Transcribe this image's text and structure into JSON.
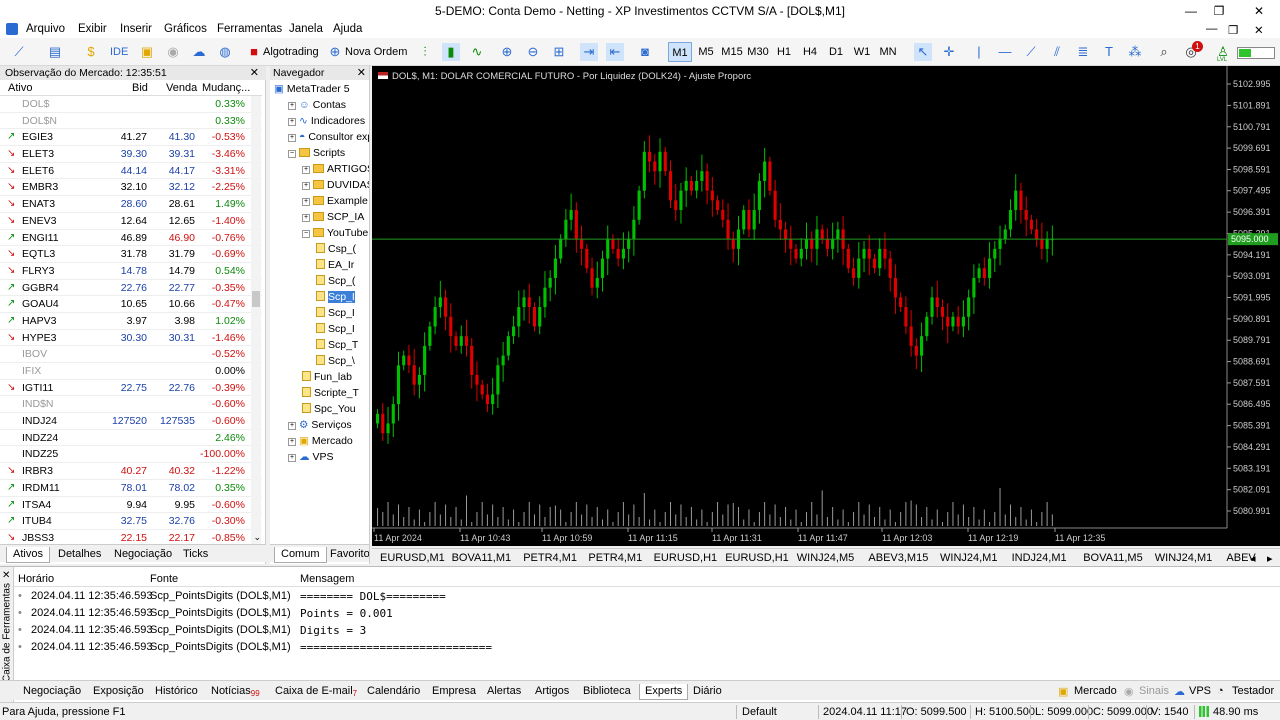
{
  "window": {
    "title": "5-DEMO: Conta Demo - Netting - XP Investimentos CCTVM S/A - [DOL$,M1]"
  },
  "menu": [
    "Arquivo",
    "Exibir",
    "Inserir",
    "Gráficos",
    "Ferramentas",
    "Janela",
    "Ajuda"
  ],
  "toolbar": {
    "ide": "IDE",
    "algotrading": "Algotrading",
    "nova_ordem": "Nova Ordem",
    "timeframes": [
      "M1",
      "M5",
      "M15",
      "M30",
      "H1",
      "H4",
      "D1",
      "W1",
      "MN"
    ],
    "active_timeframe": "M1",
    "notification_count": "1",
    "level_label": "LVL"
  },
  "market_watch": {
    "header": "Observação do Mercado: 12:35:51",
    "columns": [
      "Ativo",
      "Bid",
      "Venda",
      "Mudanç..."
    ],
    "rows": [
      {
        "symbol": "DOL$",
        "bid": "",
        "ask": "",
        "change": "0.33%",
        "dir": "none",
        "state": "inactive",
        "bidc": "",
        "askc": "",
        "chgc": "up"
      },
      {
        "symbol": "DOL$N",
        "bid": "",
        "ask": "",
        "change": "0.33%",
        "dir": "none",
        "state": "inactive",
        "bidc": "",
        "askc": "",
        "chgc": "up"
      },
      {
        "symbol": "EGIE3",
        "bid": "41.27",
        "ask": "41.30",
        "change": "-0.53%",
        "dir": "up",
        "state": "",
        "bidc": "",
        "askc": "bluev",
        "chgc": "dn"
      },
      {
        "symbol": "ELET3",
        "bid": "39.30",
        "ask": "39.31",
        "change": "-3.46%",
        "dir": "dn",
        "state": "",
        "bidc": "bluev",
        "askc": "bluev",
        "chgc": "dn"
      },
      {
        "symbol": "ELET6",
        "bid": "44.14",
        "ask": "44.17",
        "change": "-3.31%",
        "dir": "dn",
        "state": "",
        "bidc": "bluev",
        "askc": "bluev",
        "chgc": "dn"
      },
      {
        "symbol": "EMBR3",
        "bid": "32.10",
        "ask": "32.12",
        "change": "-2.25%",
        "dir": "dn",
        "state": "",
        "bidc": "",
        "askc": "bluev",
        "chgc": "dn"
      },
      {
        "symbol": "ENAT3",
        "bid": "28.60",
        "ask": "28.61",
        "change": "1.49%",
        "dir": "dn",
        "state": "",
        "bidc": "bluev",
        "askc": "",
        "chgc": "up"
      },
      {
        "symbol": "ENEV3",
        "bid": "12.64",
        "ask": "12.65",
        "change": "-1.40%",
        "dir": "dn",
        "state": "",
        "bidc": "",
        "askc": "",
        "chgc": "dn"
      },
      {
        "symbol": "ENGI11",
        "bid": "46.89",
        "ask": "46.90",
        "change": "-0.76%",
        "dir": "up",
        "state": "",
        "bidc": "",
        "askc": "redv",
        "chgc": "dn"
      },
      {
        "symbol": "EQTL3",
        "bid": "31.78",
        "ask": "31.79",
        "change": "-0.69%",
        "dir": "dn",
        "state": "",
        "bidc": "",
        "askc": "",
        "chgc": "dn"
      },
      {
        "symbol": "FLRY3",
        "bid": "14.78",
        "ask": "14.79",
        "change": "0.54%",
        "dir": "dn",
        "state": "",
        "bidc": "bluev",
        "askc": "",
        "chgc": "up"
      },
      {
        "symbol": "GGBR4",
        "bid": "22.76",
        "ask": "22.77",
        "change": "-0.35%",
        "dir": "up",
        "state": "",
        "bidc": "bluev",
        "askc": "bluev",
        "chgc": "dn"
      },
      {
        "symbol": "GOAU4",
        "bid": "10.65",
        "ask": "10.66",
        "change": "-0.47%",
        "dir": "up",
        "state": "",
        "bidc": "",
        "askc": "",
        "chgc": "dn"
      },
      {
        "symbol": "HAPV3",
        "bid": "3.97",
        "ask": "3.98",
        "change": "1.02%",
        "dir": "up",
        "state": "",
        "bidc": "",
        "askc": "",
        "chgc": "up"
      },
      {
        "symbol": "HYPE3",
        "bid": "30.30",
        "ask": "30.31",
        "change": "-1.46%",
        "dir": "dn",
        "state": "",
        "bidc": "bluev",
        "askc": "bluev",
        "chgc": "dn"
      },
      {
        "symbol": "IBOV",
        "bid": "",
        "ask": "",
        "change": "-0.52%",
        "dir": "none",
        "state": "inactive",
        "bidc": "",
        "askc": "",
        "chgc": "dn"
      },
      {
        "symbol": "IFIX",
        "bid": "",
        "ask": "",
        "change": "0.00%",
        "dir": "none",
        "state": "inactive",
        "bidc": "",
        "askc": "",
        "chgc": ""
      },
      {
        "symbol": "IGTI11",
        "bid": "22.75",
        "ask": "22.76",
        "change": "-0.39%",
        "dir": "dn",
        "state": "",
        "bidc": "bluev",
        "askc": "bluev",
        "chgc": "dn"
      },
      {
        "symbol": "IND$N",
        "bid": "",
        "ask": "",
        "change": "-0.60%",
        "dir": "none",
        "state": "inactive",
        "bidc": "",
        "askc": "",
        "chgc": "dn"
      },
      {
        "symbol": "INDJ24",
        "bid": "127520",
        "ask": "127535",
        "change": "-0.60%",
        "dir": "none",
        "state": "",
        "bidc": "bluev",
        "askc": "bluev",
        "chgc": "dn"
      },
      {
        "symbol": "INDZ24",
        "bid": "",
        "ask": "",
        "change": "2.46%",
        "dir": "none",
        "state": "",
        "bidc": "",
        "askc": "",
        "chgc": "up"
      },
      {
        "symbol": "INDZ25",
        "bid": "",
        "ask": "",
        "change": "-100.00%",
        "dir": "none",
        "state": "",
        "bidc": "",
        "askc": "",
        "chgc": "dn"
      },
      {
        "symbol": "IRBR3",
        "bid": "40.27",
        "ask": "40.32",
        "change": "-1.22%",
        "dir": "dn",
        "state": "",
        "bidc": "redv",
        "askc": "redv",
        "chgc": "dn"
      },
      {
        "symbol": "IRDM11",
        "bid": "78.01",
        "ask": "78.02",
        "change": "0.35%",
        "dir": "up",
        "state": "",
        "bidc": "bluev",
        "askc": "bluev",
        "chgc": "up"
      },
      {
        "symbol": "ITSA4",
        "bid": "9.94",
        "ask": "9.95",
        "change": "-0.60%",
        "dir": "up",
        "state": "",
        "bidc": "",
        "askc": "",
        "chgc": "dn"
      },
      {
        "symbol": "ITUB4",
        "bid": "32.75",
        "ask": "32.76",
        "change": "-0.30%",
        "dir": "up",
        "state": "",
        "bidc": "bluev",
        "askc": "bluev",
        "chgc": "dn"
      },
      {
        "symbol": "JBSS3",
        "bid": "22.15",
        "ask": "22.17",
        "change": "-0.85%",
        "dir": "dn",
        "state": "",
        "bidc": "redv",
        "askc": "redv",
        "chgc": "dn"
      }
    ],
    "tabs": [
      "Ativos",
      "Detalhes",
      "Negociação",
      "Ticks"
    ]
  },
  "navigator": {
    "header": "Navegador",
    "items": [
      {
        "label": "MetaTrader 5",
        "kind": "root",
        "level": 0
      },
      {
        "label": "Contas",
        "kind": "accounts",
        "level": 1
      },
      {
        "label": "Indicadores",
        "kind": "indicators",
        "level": 1
      },
      {
        "label": "Consultor exp",
        "kind": "experts",
        "level": 1
      },
      {
        "label": "Scripts",
        "kind": "folder",
        "level": 1
      },
      {
        "label": "ARTIGOS",
        "kind": "folder",
        "level": 2
      },
      {
        "label": "DUVIDAS",
        "kind": "folder",
        "level": 2
      },
      {
        "label": "Example",
        "kind": "folder",
        "level": 2
      },
      {
        "label": "SCP_IA",
        "kind": "folder",
        "level": 2
      },
      {
        "label": "YouTube",
        "kind": "folder",
        "level": 2
      },
      {
        "label": "Csp_(",
        "kind": "script",
        "level": 3
      },
      {
        "label": "EA_Ir",
        "kind": "script",
        "level": 3
      },
      {
        "label": "Scp_(",
        "kind": "script",
        "level": 3
      },
      {
        "label": "Scp_I",
        "kind": "script",
        "level": 3,
        "selected": true
      },
      {
        "label": "Scp_I",
        "kind": "script",
        "level": 3
      },
      {
        "label": "Scp_I",
        "kind": "script",
        "level": 3
      },
      {
        "label": "Scp_T",
        "kind": "script",
        "level": 3
      },
      {
        "label": "Scp_\\",
        "kind": "script",
        "level": 3
      },
      {
        "label": "Fun_lab",
        "kind": "script",
        "level": 2
      },
      {
        "label": "Scripte_T",
        "kind": "script",
        "level": 2
      },
      {
        "label": "Spc_You",
        "kind": "script",
        "level": 2
      },
      {
        "label": "Serviços",
        "kind": "services",
        "level": 1
      },
      {
        "label": "Mercado",
        "kind": "market",
        "level": 1
      },
      {
        "label": "VPS",
        "kind": "vps",
        "level": 1
      }
    ],
    "tabs": [
      "Comum",
      "Favorito"
    ]
  },
  "chart": {
    "info": "DOL$, M1:  DOLAR COMERCIAL FUTURO - Por Liquidez (DOLK24) - Ajuste Proporc",
    "current_price": "5095.000",
    "bull_color": "#00c000",
    "bear_color": "#e00000"
  },
  "chart_data": {
    "type": "candlestick",
    "symbol": "DOL$",
    "timeframe": "M1",
    "y_ticks": [
      "5102.995",
      "5101.891",
      "5100.791",
      "5099.691",
      "5098.591",
      "5097.495",
      "5096.391",
      "5095.291",
      "5094.191",
      "5093.091",
      "5091.995",
      "5090.891",
      "5089.791",
      "5088.691",
      "5087.591",
      "5086.495",
      "5085.391",
      "5084.291",
      "5083.191",
      "5082.091",
      "5080.991"
    ],
    "y_range": [
      5080.5,
      5103.5
    ],
    "x_ticks": [
      "11 Apr 2024",
      "11 Apr 10:43",
      "11 Apr 10:59",
      "11 Apr 11:15",
      "11 Apr 11:31",
      "11 Apr 11:47",
      "11 Apr 12:03",
      "11 Apr 12:19",
      "11 Apr 12:35"
    ],
    "closes": [
      5086.0,
      5085.0,
      5085.5,
      5086.5,
      5088.5,
      5089.0,
      5088.5,
      5087.5,
      5088.0,
      5089.5,
      5090.5,
      5091.5,
      5092.0,
      5091.0,
      5090.0,
      5089.5,
      5090.0,
      5089.5,
      5088.0,
      5087.5,
      5087.0,
      5086.5,
      5087.0,
      5088.5,
      5089.0,
      5090.0,
      5090.5,
      5091.5,
      5092.0,
      5091.5,
      5090.5,
      5091.5,
      5092.5,
      5093.0,
      5094.0,
      5095.0,
      5096.0,
      5096.5,
      5095.0,
      5094.5,
      5093.5,
      5092.5,
      5093.0,
      5094.0,
      5095.0,
      5094.5,
      5094.0,
      5094.5,
      5095.0,
      5096.0,
      5097.5,
      5099.5,
      5099.0,
      5098.5,
      5099.5,
      5098.5,
      5097.0,
      5096.5,
      5097.5,
      5098.0,
      5097.5,
      5098.0,
      5098.5,
      5097.5,
      5097.0,
      5096.5,
      5096.0,
      5095.0,
      5094.5,
      5095.5,
      5096.5,
      5095.5,
      5096.5,
      5098.0,
      5099.0,
      5097.5,
      5096.0,
      5095.5,
      5095.0,
      5094.5,
      5094.0,
      5094.5,
      5095.0,
      5094.5,
      5095.5,
      5095.0,
      5094.5,
      5095.0,
      5095.5,
      5094.5,
      5093.5,
      5093.0,
      5094.0,
      5094.5,
      5094.0,
      5093.5,
      5094.5,
      5094.0,
      5093.0,
      5092.0,
      5091.5,
      5090.5,
      5089.5,
      5089.0,
      5090.0,
      5091.0,
      5092.0,
      5091.5,
      5091.0,
      5090.5,
      5091.0,
      5090.5,
      5091.0,
      5092.0,
      5093.0,
      5093.5,
      5093.0,
      5094.0,
      5094.5,
      5095.0,
      5095.5,
      5096.5,
      5097.5,
      5096.5,
      5096.0,
      5095.5,
      5095.0,
      5094.5,
      5095.0,
      5095.0
    ]
  },
  "chart_tabs": [
    "EURUSD,M1",
    "BOVA11,M1",
    "PETR4,M1",
    "PETR4,M1",
    "EURUSD,H1",
    "EURUSD,H1",
    "WINJ24,M5",
    "ABEV3,M15",
    "WINJ24,M1",
    "INDJ24,M1",
    "BOVA11,M5",
    "WINJ24,M1",
    "ABEV"
  ],
  "toolbox": {
    "side_label": "Caixa de Ferramentas",
    "columns": [
      "Horário",
      "Fonte",
      "Mensagem"
    ],
    "rows": [
      {
        "time": "2024.04.11 12:35:46.593",
        "source": "Scp_PointsDigits (DOL$,M1)",
        "message": "========   DOL$========="
      },
      {
        "time": "2024.04.11 12:35:46.593",
        "source": "Scp_PointsDigits (DOL$,M1)",
        "message": "Points = 0.001"
      },
      {
        "time": "2024.04.11 12:35:46.593",
        "source": "Scp_PointsDigits (DOL$,M1)",
        "message": "Digits = 3"
      },
      {
        "time": "2024.04.11 12:35:46.593",
        "source": "Scp_PointsDigits (DOL$,M1)",
        "message": "============================="
      }
    ],
    "tabs": [
      "Negociação",
      "Exposição",
      "Histórico",
      "Notícias",
      "Caixa de E-mail",
      "Calendário",
      "Empresa",
      "Alertas",
      "Artigos",
      "Biblioteca",
      "Experts",
      "Diário"
    ],
    "news_badge": "99",
    "mail_badge": "7",
    "active_tab": "Experts",
    "right": [
      "Mercado",
      "Sinais",
      "VPS",
      "Testador"
    ]
  },
  "status": {
    "help": "Para Ajuda, pressione F1",
    "profile": "Default",
    "datetime": "2024.04.11 11:17",
    "open": "O: 5099.500",
    "high": "H: 5100.500",
    "low": "L: 5099.000",
    "close": "C: 5099.000",
    "volume": "V: 1540",
    "ping": "48.90 ms"
  }
}
